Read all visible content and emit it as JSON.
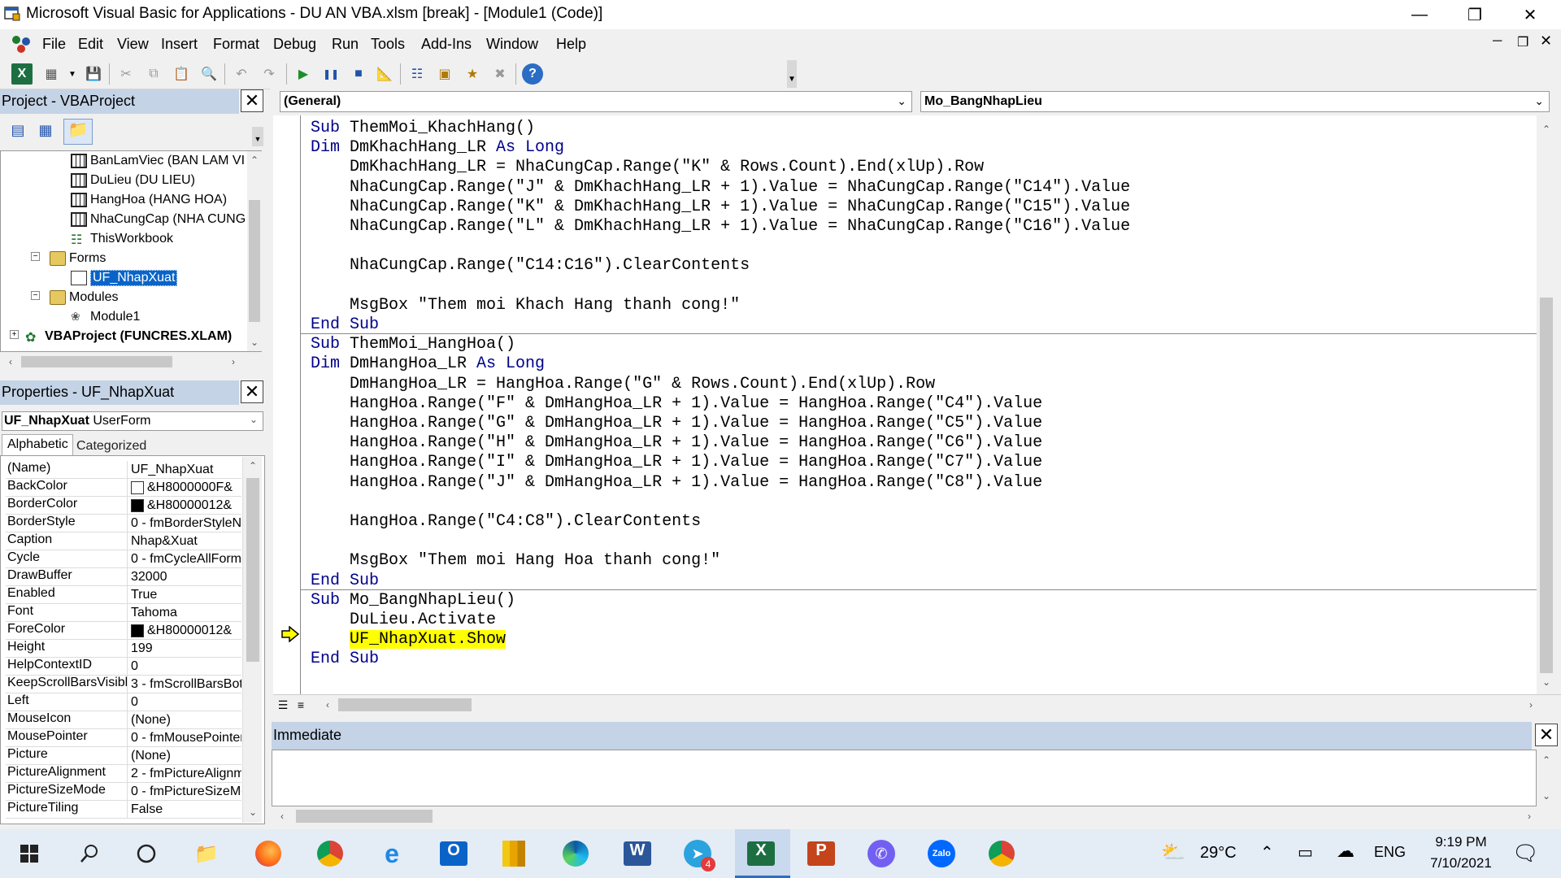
{
  "window": {
    "title": "Microsoft Visual Basic for Applications - DU AN VBA.xlsm [break] - [Module1 (Code)]"
  },
  "menu": [
    "File",
    "Edit",
    "View",
    "Insert",
    "Format",
    "Debug",
    "Run",
    "Tools",
    "Add-Ins",
    "Window",
    "Help"
  ],
  "project": {
    "title": "Project - VBAProject",
    "items": [
      "BanLamViec (BAN LAM VI",
      "DuLieu (DU LIEU)",
      "HangHoa (HANG HOA)",
      "NhaCungCap (NHA CUNG",
      "ThisWorkbook",
      "Forms",
      "UF_NhapXuat",
      "Modules",
      "Module1",
      "VBAProject (FUNCRES.XLAM)"
    ]
  },
  "properties": {
    "title": "Properties - UF_NhapXuat",
    "object_name": "UF_NhapXuat",
    "object_type": "UserForm",
    "tabs": [
      "Alphabetic",
      "Categorized"
    ],
    "rows": [
      {
        "name": "(Name)",
        "value": "UF_NhapXuat"
      },
      {
        "name": "BackColor",
        "value": "&H8000000F&"
      },
      {
        "name": "BorderColor",
        "value": "&H80000012&"
      },
      {
        "name": "BorderStyle",
        "value": "0 - fmBorderStyleN"
      },
      {
        "name": "Caption",
        "value": "Nhap&Xuat"
      },
      {
        "name": "Cycle",
        "value": "0 - fmCycleAllForm"
      },
      {
        "name": "DrawBuffer",
        "value": "32000"
      },
      {
        "name": "Enabled",
        "value": "True"
      },
      {
        "name": "Font",
        "value": "Tahoma"
      },
      {
        "name": "ForeColor",
        "value": "&H80000012&"
      },
      {
        "name": "Height",
        "value": "199"
      },
      {
        "name": "HelpContextID",
        "value": "0"
      },
      {
        "name": "KeepScrollBarsVisible",
        "value": "3 - fmScrollBarsBot"
      },
      {
        "name": "Left",
        "value": "0"
      },
      {
        "name": "MouseIcon",
        "value": "(None)"
      },
      {
        "name": "MousePointer",
        "value": "0 - fmMousePointer"
      },
      {
        "name": "Picture",
        "value": "(None)"
      },
      {
        "name": "PictureAlignment",
        "value": "2 - fmPictureAlignm"
      },
      {
        "name": "PictureSizeMode",
        "value": "0 - fmPictureSizeMc"
      },
      {
        "name": "PictureTiling",
        "value": "False"
      }
    ]
  },
  "code": {
    "object_combo": "(General)",
    "proc_combo": "Mo_BangNhapLieu",
    "lines": [
      [
        {
          "t": "Sub",
          "k": 1
        },
        {
          "t": " ThemMoi_KhachHang()"
        }
      ],
      [
        {
          "t": "Dim",
          "k": 1
        },
        {
          "t": " DmKhachHang_LR "
        },
        {
          "t": "As Long",
          "k": 1
        }
      ],
      [
        {
          "t": "    DmKhachHang_LR = NhaCungCap.Range(\"K\" & Rows.Count).End(xlUp).Row"
        }
      ],
      [
        {
          "t": "    NhaCungCap.Range(\"J\" & DmKhachHang_LR + 1).Value = NhaCungCap.Range(\"C14\").Value"
        }
      ],
      [
        {
          "t": "    NhaCungCap.Range(\"K\" & DmKhachHang_LR + 1).Value = NhaCungCap.Range(\"C15\").Value"
        }
      ],
      [
        {
          "t": "    NhaCungCap.Range(\"L\" & DmKhachHang_LR + 1).Value = NhaCungCap.Range(\"C16\").Value"
        }
      ],
      [],
      [
        {
          "t": "    NhaCungCap.Range(\"C14:C16\").ClearContents"
        }
      ],
      [],
      [
        {
          "t": "    MsgBox \"Them moi Khach Hang thanh cong!\""
        }
      ],
      [
        {
          "t": "End Sub",
          "k": 1
        }
      ],
      [
        {
          "t": "Sub",
          "k": 1
        },
        {
          "t": " ThemMoi_HangHoa()"
        }
      ],
      [
        {
          "t": "Dim",
          "k": 1
        },
        {
          "t": " DmHangHoa_LR "
        },
        {
          "t": "As Long",
          "k": 1
        }
      ],
      [
        {
          "t": "    DmHangHoa_LR = HangHoa.Range(\"G\" & Rows.Count).End(xlUp).Row"
        }
      ],
      [
        {
          "t": "    HangHoa.Range(\"F\" & DmHangHoa_LR + 1).Value = HangHoa.Range(\"C4\").Value"
        }
      ],
      [
        {
          "t": "    HangHoa.Range(\"G\" & DmHangHoa_LR + 1).Value = HangHoa.Range(\"C5\").Value"
        }
      ],
      [
        {
          "t": "    HangHoa.Range(\"H\" & DmHangHoa_LR + 1).Value = HangHoa.Range(\"C6\").Value"
        }
      ],
      [
        {
          "t": "    HangHoa.Range(\"I\" & DmHangHoa_LR + 1).Value = HangHoa.Range(\"C7\").Value"
        }
      ],
      [
        {
          "t": "    HangHoa.Range(\"J\" & DmHangHoa_LR + 1).Value = HangHoa.Range(\"C8\").Value"
        }
      ],
      [],
      [
        {
          "t": "    HangHoa.Range(\"C4:C8\").ClearContents"
        }
      ],
      [],
      [
        {
          "t": "    MsgBox \"Them moi Hang Hoa thanh cong!\""
        }
      ],
      [
        {
          "t": "End Sub",
          "k": 1
        }
      ],
      [
        {
          "t": "Sub",
          "k": 1
        },
        {
          "t": " Mo_BangNhapLieu()"
        }
      ],
      [
        {
          "t": "    DuLieu.Activate"
        }
      ],
      [
        {
          "t": "    "
        },
        {
          "t": "UF_NhapXuat.Show",
          "h": 1
        }
      ],
      [
        {
          "t": "End Sub",
          "k": 1
        }
      ]
    ]
  },
  "immediate": {
    "title": "Immediate"
  },
  "taskbar": {
    "temperature": "29°C",
    "language": "ENG",
    "time": "9:19 PM",
    "date": "7/10/2021",
    "telegram_badge": "4"
  },
  "colors": {
    "keyword": "#00008b",
    "highlight": "#ffff00",
    "panel_header": "#c4d3e6"
  }
}
